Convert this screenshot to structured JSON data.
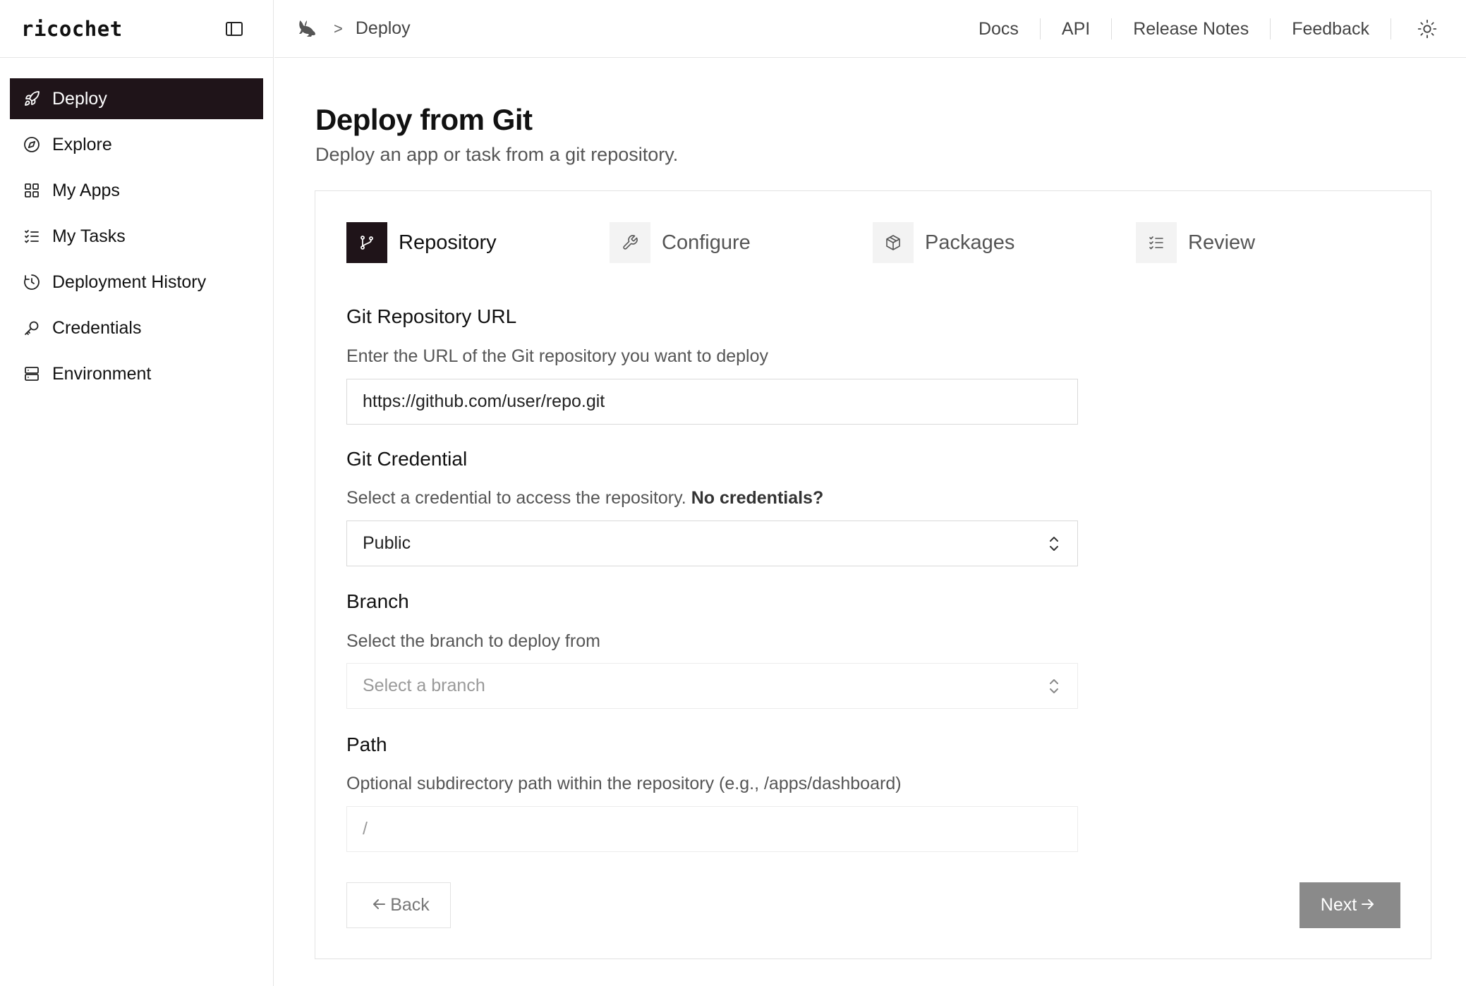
{
  "app": {
    "logo": "ricochet"
  },
  "sidebar": {
    "items": [
      {
        "label": "Deploy",
        "icon": "rocket-icon",
        "active": true
      },
      {
        "label": "Explore",
        "icon": "compass-icon"
      },
      {
        "label": "My Apps",
        "icon": "grid-icon"
      },
      {
        "label": "My Tasks",
        "icon": "list-checks-icon"
      },
      {
        "label": "Deployment History",
        "icon": "history-icon"
      },
      {
        "label": "Credentials",
        "icon": "key-icon"
      },
      {
        "label": "Environment",
        "icon": "server-icon"
      }
    ]
  },
  "topbar": {
    "breadcrumb_icon": "rabbit-icon",
    "breadcrumb": "Deploy",
    "links": [
      "Docs",
      "API",
      "Release Notes",
      "Feedback"
    ],
    "theme_icon": "sun-icon"
  },
  "page": {
    "title": "Deploy from Git",
    "subtitle": "Deploy an app or task from a git repository."
  },
  "steps": [
    {
      "label": "Repository",
      "icon": "git-branch-icon",
      "active": true
    },
    {
      "label": "Configure",
      "icon": "wrench-icon"
    },
    {
      "label": "Packages",
      "icon": "package-icon"
    },
    {
      "label": "Review",
      "icon": "list-checks-icon"
    }
  ],
  "form": {
    "repo": {
      "label": "Git Repository URL",
      "description": "Enter the URL of the Git repository you want to deploy",
      "value": "https://github.com/user/repo.git"
    },
    "credential": {
      "label": "Git Credential",
      "description": "Select a credential to access the repository.",
      "link": "No credentials?",
      "value": "Public"
    },
    "branch": {
      "label": "Branch",
      "description": "Select the branch to deploy from",
      "placeholder": "Select a branch"
    },
    "path": {
      "label": "Path",
      "description": "Optional subdirectory path within the repository (e.g., /apps/dashboard)",
      "placeholder": "/"
    }
  },
  "buttons": {
    "back": "Back",
    "next": "Next"
  },
  "colors": {
    "accent": "#1f1419",
    "next_disabled": "#8a8a8a"
  }
}
